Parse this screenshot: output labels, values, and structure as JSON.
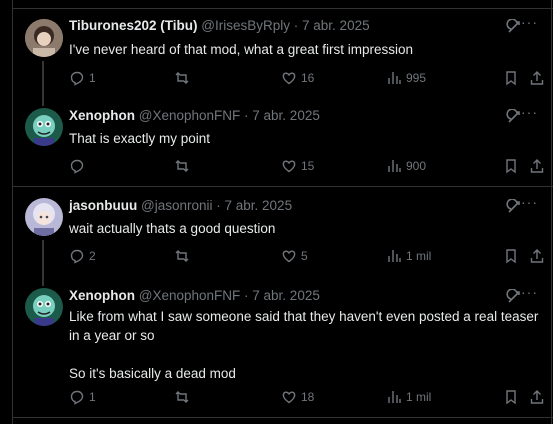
{
  "posts": [
    {
      "name": "Tiburones202 (Tibu)",
      "handle": "@IrisesByRply",
      "date": "7 abr. 2025",
      "lines": [
        "I've never heard of that mod, what a great first impression"
      ],
      "replies": "1",
      "reposts": "",
      "likes": "16",
      "views": "995"
    },
    {
      "name": "Xenophon",
      "handle": "@XenophonFNF",
      "date": "7 abr. 2025",
      "lines": [
        "That is exactly my point"
      ],
      "replies": "",
      "reposts": "",
      "likes": "15",
      "views": "900"
    },
    {
      "name": "jasonbuuu",
      "handle": "@jasonronii",
      "date": "7 abr. 2025",
      "lines": [
        "wait actually thats a good question"
      ],
      "replies": "2",
      "reposts": "",
      "likes": "5",
      "views": "1 mil"
    },
    {
      "name": "Xenophon",
      "handle": "@XenophonFNF",
      "date": "7 abr. 2025",
      "lines": [
        "Like from what I saw someone said that they haven't even posted a real teaser",
        "in a year or so",
        "",
        "So it's basically a dead mod"
      ],
      "replies": "1",
      "reposts": "",
      "likes": "18",
      "views": "1 mil"
    }
  ],
  "separator": " · ",
  "more_label": "···",
  "colors": {
    "background": "#000000",
    "primary_text": "#e7e9ea",
    "secondary_text": "#71767b",
    "border": "#2f3336"
  }
}
